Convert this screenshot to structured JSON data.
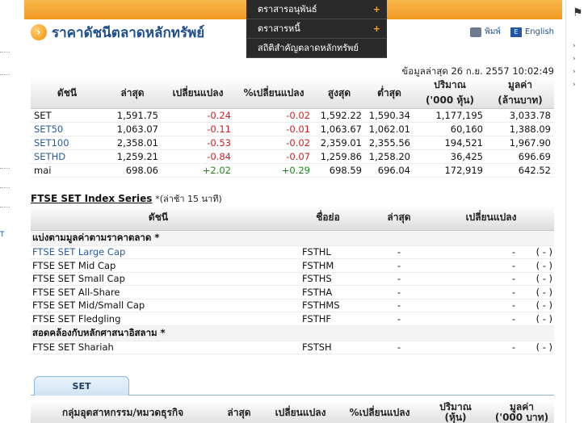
{
  "left_nav": {
    "fragment": "T"
  },
  "dropdown": {
    "items": [
      {
        "label": "ตราสารอนุพันธ์",
        "has_sub": "+"
      },
      {
        "label": "ตราสารหนี้",
        "has_sub": "+"
      },
      {
        "label": "สถิติสำคัญตลาดหลักทรัพย์",
        "has_sub": ""
      }
    ]
  },
  "header": {
    "title": "ราคาดัชนีตลาดหลักทรัพย์",
    "print_label": "พิมพ์",
    "english_label": "English",
    "updated": "ข้อมูลล่าสุด 26 ก.ย. 2557 10:02:49"
  },
  "index_table": {
    "headers": [
      "ดัชนี",
      "ล่าสุด",
      "เปลี่ยนแปลง",
      "%เปลี่ยนแปลง",
      "สูงสุด",
      "ต่ำสุด",
      "ปริมาณ\n('000 หุ้น)",
      "มูลค่า\n(ล้านบาท)"
    ],
    "rows": [
      {
        "name": "SET",
        "last": "1,591.75",
        "chg": "-0.24",
        "pct": "-0.02",
        "high": "1,592.22",
        "low": "1,590.34",
        "vol": "1,177,195",
        "val": "3,033.78"
      },
      {
        "name": "SET50",
        "last": "1,063.07",
        "chg": "-0.11",
        "pct": "-0.01",
        "high": "1,063.67",
        "low": "1,062.01",
        "vol": "60,160",
        "val": "1,388.09"
      },
      {
        "name": "SET100",
        "last": "2,358.01",
        "chg": "-0.53",
        "pct": "-0.02",
        "high": "2,359.01",
        "low": "2,355.56",
        "vol": "194,521",
        "val": "1,967.90"
      },
      {
        "name": "SETHD",
        "last": "1,259.21",
        "chg": "-0.84",
        "pct": "-0.07",
        "high": "1,259.86",
        "low": "1,258.20",
        "vol": "36,425",
        "val": "696.69"
      },
      {
        "name": "mai",
        "last": "698.06",
        "chg": "+2.02",
        "pct": "+0.29",
        "high": "698.59",
        "low": "696.04",
        "vol": "172,919",
        "val": "642.52"
      }
    ]
  },
  "ftse": {
    "title": "FTSE SET Index Series",
    "note": "*(ล่าช้า 15 นาที)",
    "headers": [
      "ดัชนี",
      "ชื่อย่อ",
      "ล่าสุด",
      "เปลี่ยนแปลง"
    ],
    "group1": "แบ่งตามมูลค่าตามราคาตลาด *",
    "rows1": [
      {
        "name": "FTSE SET Large Cap",
        "code": "FSTHL",
        "last": "-",
        "chg": "-",
        "pct": "( - )"
      },
      {
        "name": "FTSE SET Mid Cap",
        "code": "FSTHM",
        "last": "-",
        "chg": "-",
        "pct": "( - )"
      },
      {
        "name": "FTSE SET Small Cap",
        "code": "FSTHS",
        "last": "-",
        "chg": "-",
        "pct": "( - )"
      },
      {
        "name": "FTSE SET All-Share",
        "code": "FSTHA",
        "last": "-",
        "chg": "-",
        "pct": "( - )"
      },
      {
        "name": "FTSE SET Mid/Small Cap",
        "code": "FSTHMS",
        "last": "-",
        "chg": "-",
        "pct": "( - )"
      },
      {
        "name": "FTSE SET Fledgling",
        "code": "FSTHF",
        "last": "-",
        "chg": "-",
        "pct": "( - )"
      }
    ],
    "group2": "สอดคล้องกับหลักศาสนาอิสลาม *",
    "rows2": [
      {
        "name": "FTSE SET Shariah",
        "code": "FSTSH",
        "last": "-",
        "chg": "-",
        "pct": "( - )"
      }
    ]
  },
  "tabs": {
    "set_tab": "SET"
  },
  "sector_table": {
    "headers": [
      "กลุ่มอุตสาหกรรม/หมวดธุรกิจ",
      "ล่าสุด",
      "เปลี่ยนแปลง",
      "%เปลี่ยนแปลง",
      "ปริมาณ\n(หุ้น)",
      "มูลค่า\n('000 บาท)"
    ]
  },
  "colors": {
    "accent": "#f29b22",
    "negative": "#d21f1f",
    "positive": "#1b8a1b",
    "link": "#2a5c9e"
  }
}
